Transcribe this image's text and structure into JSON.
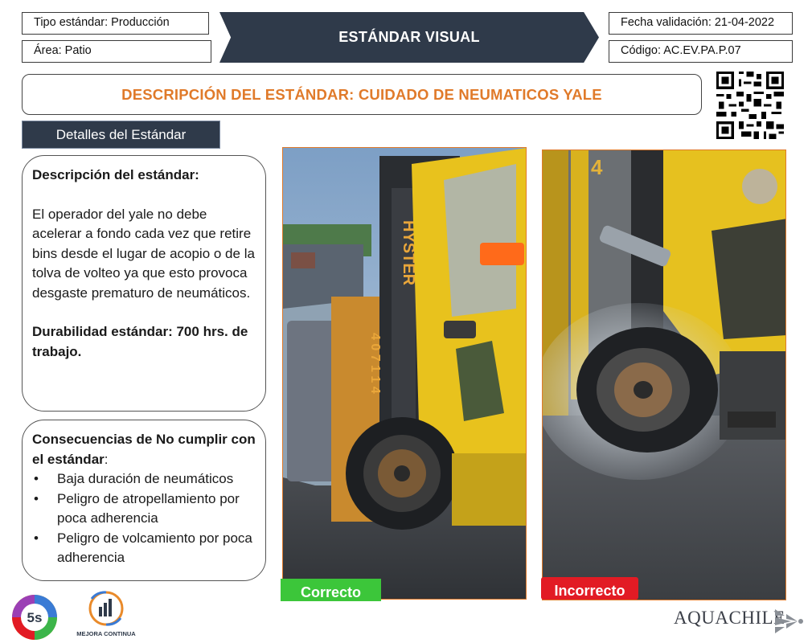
{
  "header": {
    "tipo_estandar": "Tipo estándar: Producción",
    "area": "Área: Patio",
    "banner_title": "ESTÁNDAR VISUAL",
    "fecha_validacion": "Fecha validación: 21-04-2022",
    "codigo": "Código: AC.EV.PA.P.07"
  },
  "description_title": "DESCRIPCIÓN DEL ESTÁNDAR: CUIDADO DE NEUMATICOS YALE",
  "details_tab": "Detalles del Estándar",
  "standard_card": {
    "heading": "Descripción del estándar:",
    "body": "El operador del yale no debe acelerar a fondo cada vez que retire bins desde el lugar de acopio o de la tolva de volteo ya que esto provoca desgaste prematuro de neumáticos.",
    "durability": "Durabilidad estándar: 700 hrs. de trabajo."
  },
  "consequences_card": {
    "heading_bold": "Consecuencias de No cumplir con el estándar",
    "heading_suffix": ":",
    "items": [
      "Baja duración de neumáticos",
      "Peligro de atropellamiento por poca adherencia",
      "Peligro de volcamiento por poca adherencia"
    ]
  },
  "photos": {
    "correct_label": "Correcto",
    "incorrect_label": "Incorrecto",
    "forklift_brand": "HYSTER",
    "mast_number": "4 0 7 1 1 4",
    "panel_number": "4"
  },
  "footer": {
    "logo_5s_text": "5s",
    "mejora_text": "MEJORA CONTINUA",
    "brand_name": "AQUACHILE"
  },
  "colors": {
    "navy": "#2f3a4a",
    "orange": "#e07a2a",
    "correct_green": "#3cc63a",
    "incorrect_red": "#e21b24"
  }
}
